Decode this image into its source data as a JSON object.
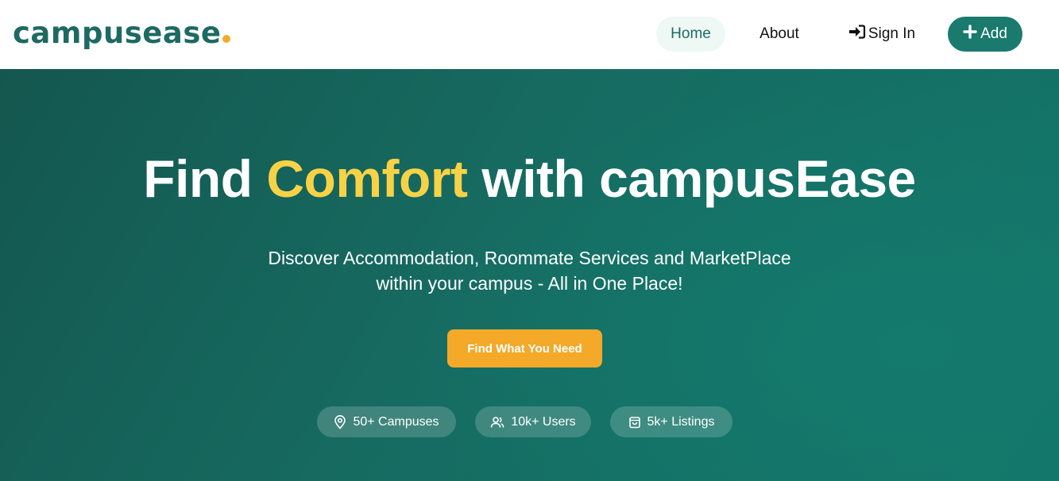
{
  "brand": {
    "name": "campusease",
    "accent_color": "#f4a929",
    "primary_color": "#1d6a63"
  },
  "nav": {
    "home": "Home",
    "about": "About",
    "sign_in": "Sign In",
    "sign_in_icon": "sign-in-icon",
    "add": "Add",
    "add_icon": "plus-icon",
    "active": "Home"
  },
  "hero": {
    "title_part1": "Find",
    "title_accent": "Comfort",
    "title_part2": "with campusEase",
    "subtitle_line1": "Discover Accommodation, Roommate Services and MarketPlace",
    "subtitle_line2": "within your campus - All in One Place!",
    "cta": "Find What You Need",
    "accent_text_color": "#f8d246"
  },
  "stats": [
    {
      "icon": "map-pin-icon",
      "label": "50+ Campuses"
    },
    {
      "icon": "users-icon",
      "label": "10k+ Users"
    },
    {
      "icon": "shopping-bag-icon",
      "label": "5k+ Listings"
    }
  ]
}
